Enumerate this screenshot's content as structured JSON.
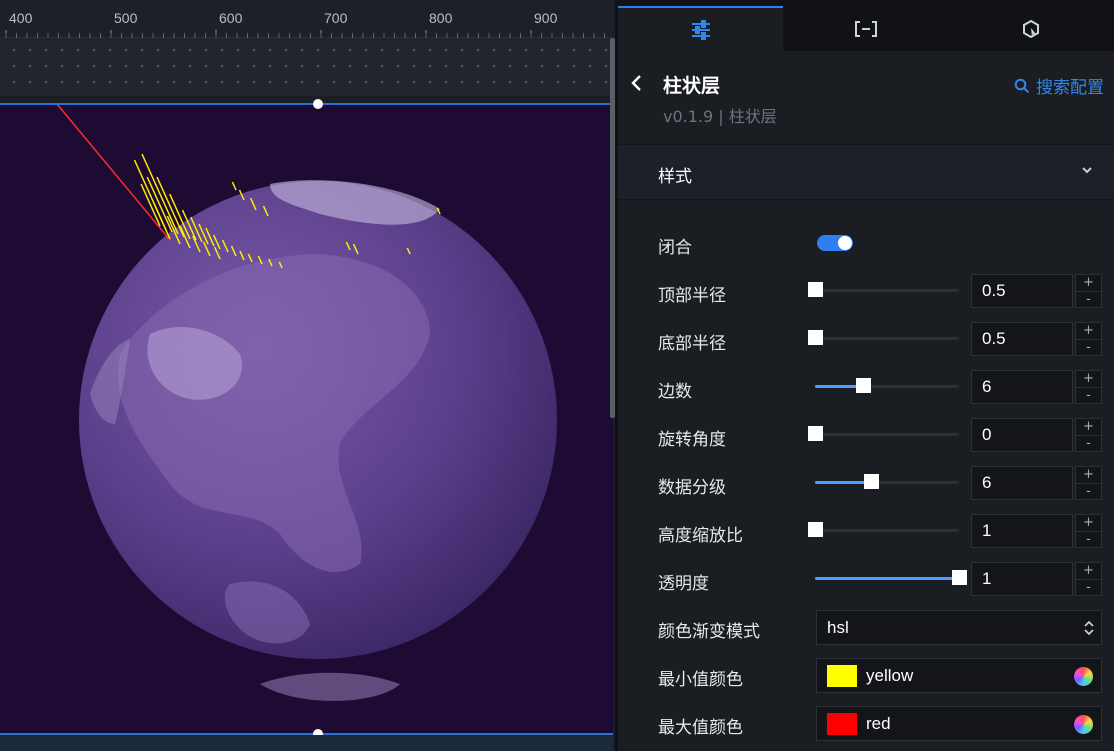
{
  "ruler": {
    "labels": [
      "400",
      "500",
      "600",
      "700",
      "800",
      "900"
    ]
  },
  "tabs": [
    {
      "icon": "sliders-icon",
      "active": true
    },
    {
      "icon": "bracket-box-icon",
      "active": false
    },
    {
      "icon": "interaction-icon",
      "active": false
    }
  ],
  "header": {
    "title": "柱状层",
    "subtitle": "v0.1.9 | 柱状层",
    "search_label": "搜索配置"
  },
  "section": {
    "title": "样式"
  },
  "fields": {
    "closed": {
      "label": "闭合",
      "on": true
    },
    "top_radius": {
      "label": "顶部半径",
      "value": "0.5",
      "fraction": 0.0
    },
    "bottom_radius": {
      "label": "底部半径",
      "value": "0.5",
      "fraction": 0.0
    },
    "sides": {
      "label": "边数",
      "value": "6",
      "fraction": 0.33
    },
    "rotation": {
      "label": "旋转角度",
      "value": "0",
      "fraction": 0.0
    },
    "data_levels": {
      "label": "数据分级",
      "value": "6",
      "fraction": 0.39
    },
    "height_scale": {
      "label": "高度缩放比",
      "value": "1",
      "fraction": 0.0
    },
    "opacity": {
      "label": "透明度",
      "value": "1",
      "fraction": 1.0
    },
    "gradient_mode": {
      "label": "颜色渐变模式",
      "value": "hsl"
    },
    "min_color": {
      "label": "最小值颜色",
      "value": "yellow",
      "color": "#ffff00"
    },
    "max_color": {
      "label": "最大值颜色",
      "value": "red",
      "color": "#ff0000"
    }
  },
  "stepper": {
    "plus": "+",
    "minus": "-"
  },
  "colors": {
    "accent": "#2f7ff0",
    "scene_bg": "#1e0b34",
    "globe": "#5a3f8a",
    "bars": "#ffee00"
  }
}
